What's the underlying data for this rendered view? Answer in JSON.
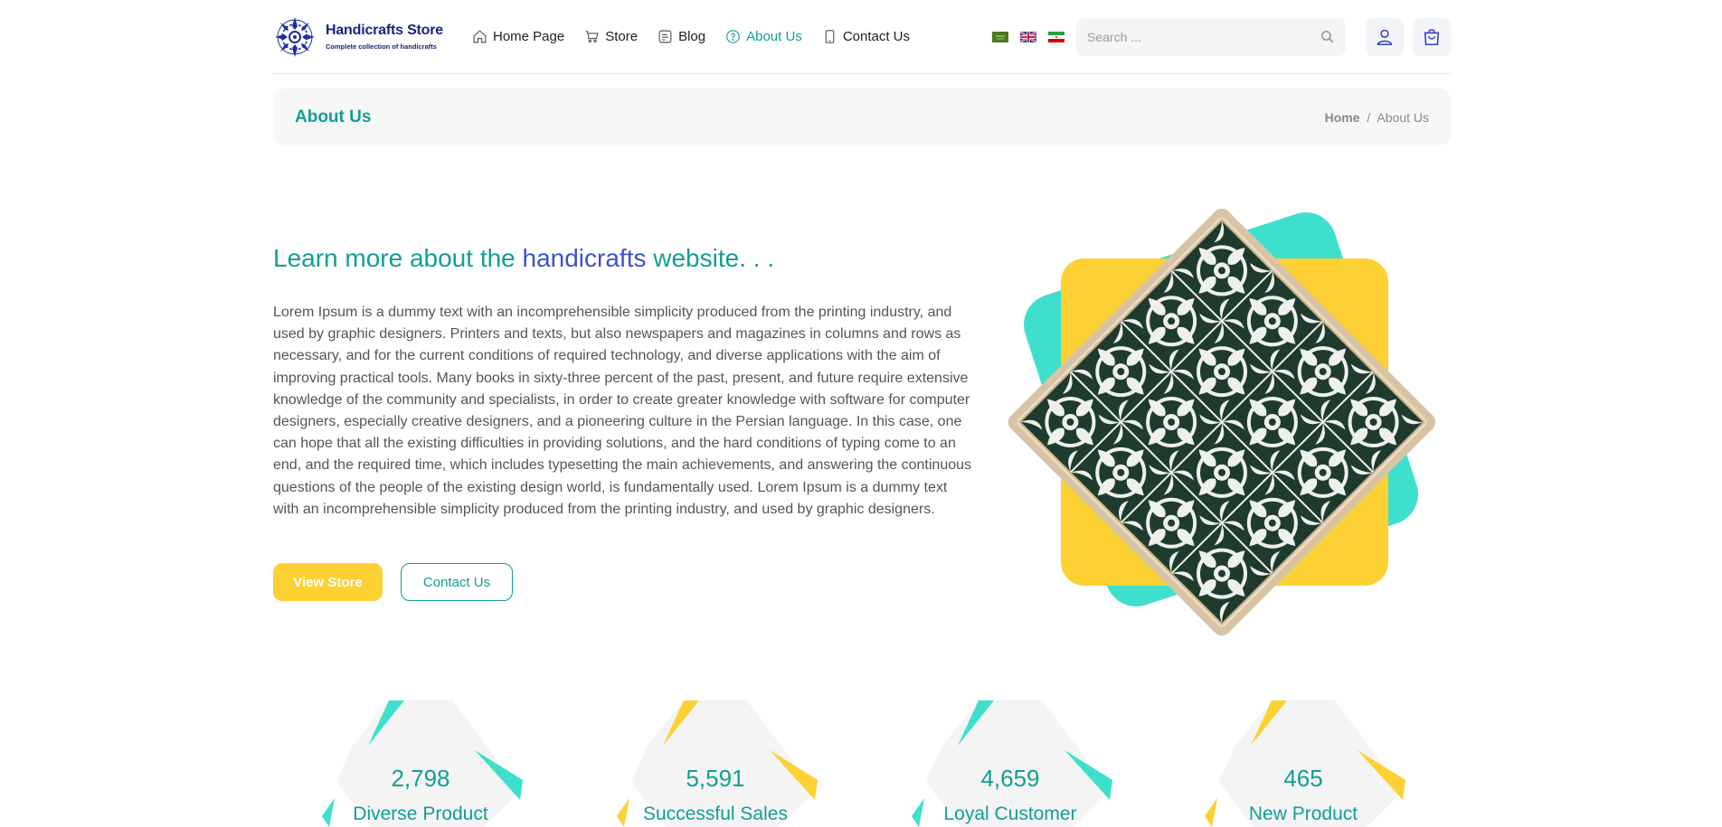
{
  "brand": {
    "title": "Handicrafts Store",
    "subtitle": "Complete collection of handicrafts"
  },
  "nav": [
    {
      "label": "Home Page",
      "icon": "home-icon"
    },
    {
      "label": "Store",
      "icon": "cart-icon"
    },
    {
      "label": "Blog",
      "icon": "blog-icon"
    },
    {
      "label": "About Us",
      "icon": "question-circle-icon",
      "active": true
    },
    {
      "label": "Contact Us",
      "icon": "phone-icon"
    }
  ],
  "languages": [
    "saudi-arabia-flag",
    "uk-flag",
    "iran-flag"
  ],
  "search": {
    "placeholder": "Search ..."
  },
  "breadcrumb": {
    "title": "About Us",
    "home": "Home",
    "separator": "/",
    "current": "About Us"
  },
  "hero": {
    "heading_pre": "Learn more about the ",
    "heading_highlight": "handicrafts",
    "heading_post": " website. . .",
    "paragraph": "Lorem Ipsum is a dummy text with an incomprehensible simplicity produced from the printing industry, and used by graphic designers. Printers and texts, but also newspapers and magazines in columns and rows as necessary, and for the current conditions of required technology, and diverse applications with the aim of improving practical tools. Many books in sixty-three percent of the past, present, and future require extensive knowledge of the community and specialists, in order to create greater knowledge with software for computer designers, especially creative designers, and a pioneering culture in the Persian language. In this case, one can hope that all the existing difficulties in providing solutions, and the hard conditions of typing come to an end, and the required time, which includes typesetting the main achievements, and answering the continuous questions of the people of the existing design world, is fundamentally used. Lorem Ipsum is a dummy text with an incomprehensible simplicity produced from the printing industry, and used by graphic designers.",
    "primary_button": "View Store",
    "secondary_button": "Contact Us"
  },
  "stats": [
    {
      "value": "2,798",
      "label": "Diverse Product",
      "accent": "#3ee0cd"
    },
    {
      "value": "5,591",
      "label": "Successful Sales",
      "accent": "#fdd133"
    },
    {
      "value": "4,659",
      "label": "Loyal Customer",
      "accent": "#3ee0cd"
    },
    {
      "value": "465",
      "label": "New Product",
      "accent": "#fdd133"
    }
  ],
  "colors": {
    "primary": "#139e94",
    "accent_blue": "#3f51c8",
    "yellow": "#fdd133",
    "turquoise": "#3ee0cd",
    "brand_navy": "#1a237e"
  }
}
